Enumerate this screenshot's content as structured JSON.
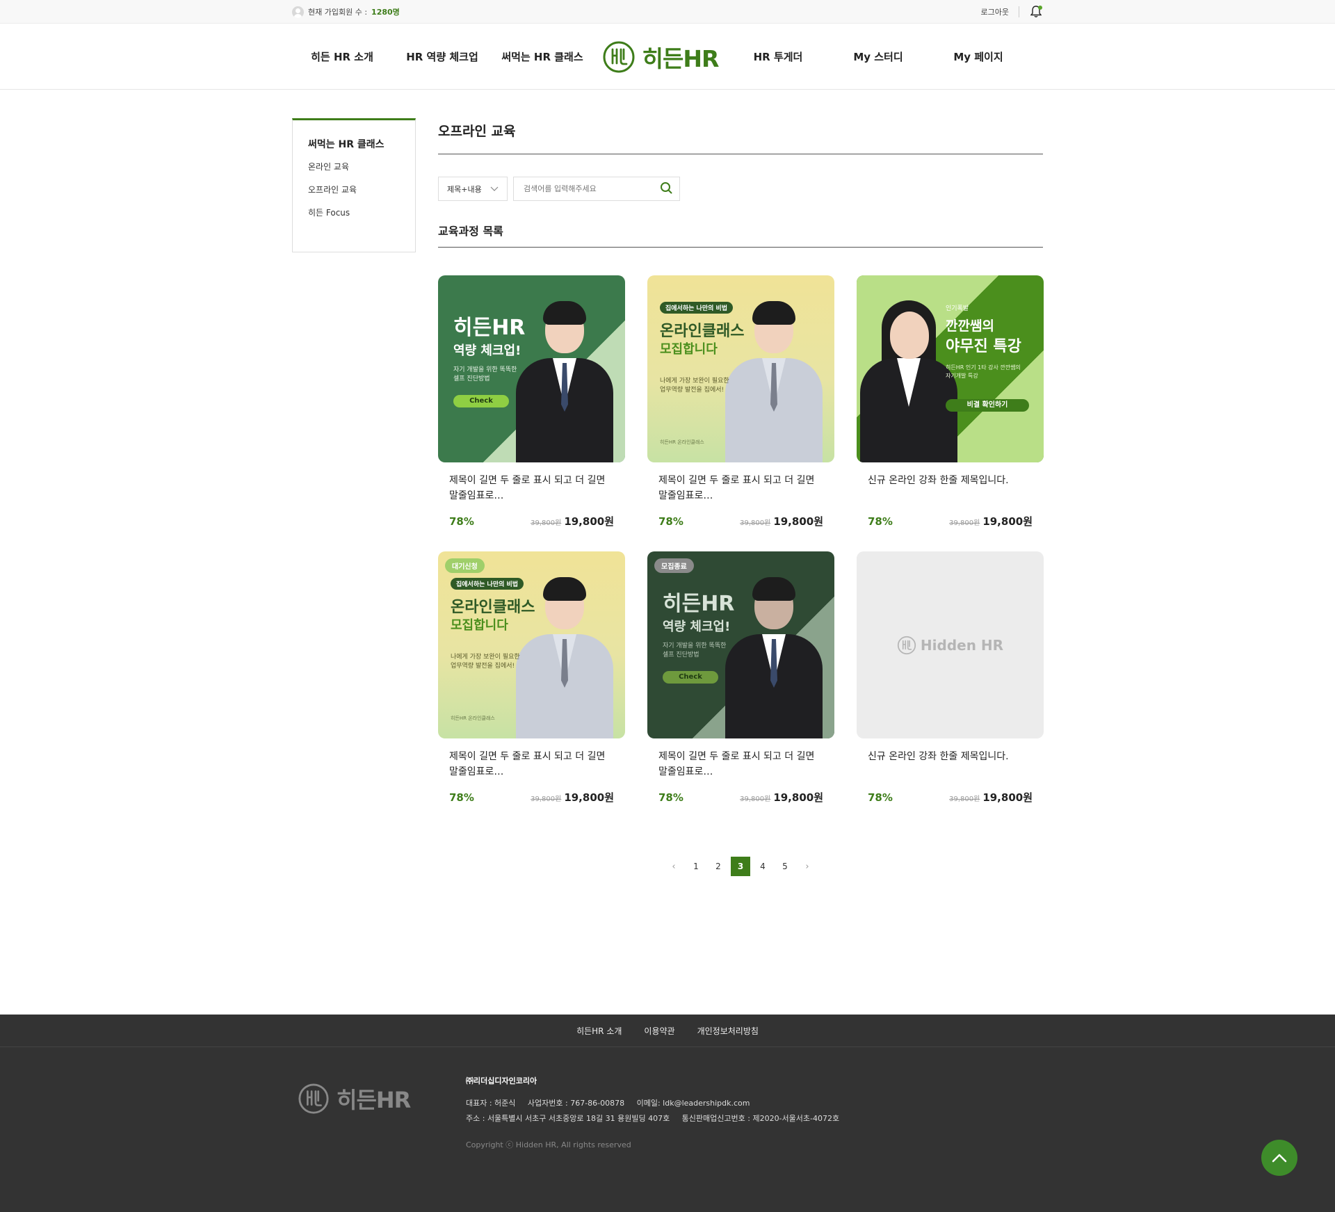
{
  "topbar": {
    "member_label": "현재 가입회원 수 :",
    "member_count": "1280명",
    "logout": "로그아웃"
  },
  "nav": {
    "items_left": [
      "히든 HR 소개",
      "HR 역량 체크업",
      "써먹는 HR 클래스"
    ],
    "logo_text": "히든HR",
    "items_right": [
      "HR 투게더",
      "My 스터디",
      "My 페이지"
    ]
  },
  "sidebar": {
    "title": "써먹는 HR 클래스",
    "items": [
      "온라인 교육",
      "오프라인 교육",
      "히든 Focus"
    ]
  },
  "main": {
    "page_title": "오프라인 교육",
    "search": {
      "select_value": "제목+내용",
      "placeholder": "검색어를 입력해주세요"
    },
    "section_title": "교육과정 목록"
  },
  "cards": [
    {
      "title": "제목이 길면 두 줄로 표시 되고 더 길면 말줄임표로…",
      "discount": "78%",
      "original_price": "39,800원",
      "price": "19,800원",
      "art": {
        "headline": "히든HR",
        "sub": "역량 체크업!",
        "desc1": "자기 개발을 위한 똑똑한",
        "desc2": "셀프 진단방법",
        "btn": "Check"
      }
    },
    {
      "title": "제목이 길면 두 줄로 표시 되고 더 길면 말줄임표로…",
      "discount": "78%",
      "original_price": "39,800원",
      "price": "19,800원",
      "art": {
        "tag": "집에서하는 나만의 비법",
        "headline": "온라인클래스",
        "sub": "모집합니다",
        "desc1": "나에게 가장 보완이 필요한",
        "desc2": "업무역량 발전을 집에서!",
        "foot": "히든HR 온라인클래스"
      }
    },
    {
      "title": "신규 온라인 강좌 한줄 제목입니다.",
      "discount": "78%",
      "original_price": "39,800원",
      "price": "19,800원",
      "art": {
        "tag": "인기폭발",
        "headline": "깐깐쌤의",
        "sub": "야무진 특강",
        "desc1": "히든HR 인기 1타 강사 깐깐쌤의",
        "desc2": "자기개발 특강",
        "btn": "비결 확인하기"
      }
    },
    {
      "title": "제목이 길면 두 줄로 표시 되고 더 길면 말줄임표로…",
      "discount": "78%",
      "original_price": "39,800원",
      "price": "19,800원",
      "badge": "대기신청",
      "art": {
        "tag": "집에서하는 나만의 비법",
        "headline": "온라인클래스",
        "sub": "모집합니다",
        "desc1": "나에게 가장 보완이 필요한",
        "desc2": "업무역량 발전을 집에서!",
        "foot": "히든HR 온라인클래스"
      }
    },
    {
      "title": "제목이 길면 두 줄로 표시 되고 더 길면 말줄임표로…",
      "discount": "78%",
      "original_price": "39,800원",
      "price": "19,800원",
      "badge": "모집종료",
      "art": {
        "headline": "히든HR",
        "sub": "역량 체크업!",
        "desc1": "자기 개발을 위한 똑똑한",
        "desc2": "셀프 진단방법",
        "btn": "Check"
      }
    },
    {
      "title": "신규 온라인 강좌 한줄 제목입니다.",
      "discount": "78%",
      "original_price": "39,800원",
      "price": "19,800원",
      "art": {
        "placeholder_logo": "Hidden HR"
      }
    }
  ],
  "pagination": {
    "pages": [
      "1",
      "2",
      "3",
      "4",
      "5"
    ],
    "current": "3"
  },
  "footer": {
    "links": [
      "히든HR 소개",
      "이용약관",
      "개인정보처리방침"
    ],
    "logo_text": "히든HR",
    "company": "㈜리더십디자인코리아",
    "line1": "대표자 : 허준식     사업자번호 : 767-86-00878     이메일: ldk@leadershipdk.com",
    "line2": "주소 : 서울특별시 서초구 서초중앙로 18길 31 용원빌딩 407호     통신판매업신고번호 : 제2020-서울서초-4072호",
    "copyright": "Copyright ⓒ Hidden HR, All rights reserved"
  },
  "colors": {
    "brand": "#3e7d1a",
    "footer_bg": "#333333"
  }
}
